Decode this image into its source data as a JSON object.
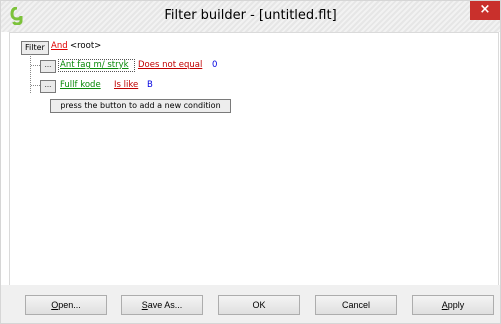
{
  "window": {
    "title": "Filter builder - [untitled.flt]",
    "close_glyph": "×",
    "accent_color": "#c9302c",
    "icon": "app-logo-icon"
  },
  "filter": {
    "root_button": "Filter",
    "group_operator": "And",
    "group_label": "<root>",
    "conditions": [
      {
        "ellipsis": "...",
        "field": "Ant fag m/ stryk",
        "operator": "Does not equal",
        "value": "0"
      },
      {
        "ellipsis": "...",
        "field": "Fullf kode",
        "operator": "Is like",
        "value": "B"
      }
    ],
    "add_condition": "press the button to add a new condition"
  },
  "colors": {
    "operator": "#e00000",
    "field": "#0a8a0a",
    "condition": "#c00000",
    "value": "#0000e0"
  },
  "footer": {
    "buttons": [
      {
        "label": "Open...",
        "mnemonic": "O",
        "rest": "pen..."
      },
      {
        "label": "Save As...",
        "mnemonic": "S",
        "rest": "ave As..."
      },
      {
        "label": "OK"
      },
      {
        "label": "Cancel"
      },
      {
        "label": "Apply",
        "mnemonic": "A",
        "rest": "pply"
      }
    ]
  }
}
